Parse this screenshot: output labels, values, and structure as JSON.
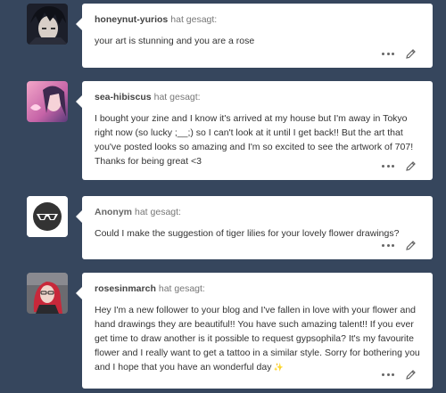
{
  "asks": [
    {
      "username": "honeynut-yurios",
      "said_label": "hat gesagt:",
      "message": "your art is stunning and you are a rose",
      "avatar_icon": "dark-haired-character-avatar"
    },
    {
      "username": "sea-hibiscus",
      "said_label": "hat gesagt:",
      "message": "I bought your zine and I know it's arrived at my house but I'm away in Tokyo right now (so lucky ;__;) so I can't look at it until I get back!! But the art that you've posted looks so amazing and I'm so excited to see the artwork of 707! Thanks for being great <3",
      "avatar_icon": "pink-purple-character-avatar"
    },
    {
      "username": "Anonym",
      "said_label": "hat gesagt:",
      "message": "Could I make the suggestion of tiger lilies for your lovely flower drawings?",
      "avatar_icon": "anonymous-sunglasses-avatar"
    },
    {
      "username": "rosesinmarch",
      "said_label": "hat gesagt:",
      "message": "Hey I'm a new follower to your blog and I've fallen in love with your flower and hand drawings they are beautiful!! You have such amazing talent!! If you ever get time to draw another is it possible to request gypsophila? It's my favourite flower and I really want to get a tattoo in a similar style. Sorry for bothering you and I hope that you have an wonderful day",
      "avatar_icon": "red-haired-person-avatar"
    }
  ],
  "action_icons": [
    "more-options-icon",
    "edit-pencil-icon"
  ],
  "colors": {
    "background": "#36465d",
    "card": "#ffffff",
    "text": "#333333"
  }
}
